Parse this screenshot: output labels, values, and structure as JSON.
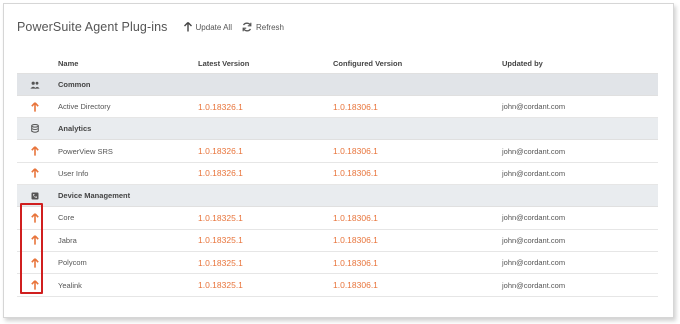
{
  "header": {
    "title": "PowerSuite Agent Plug-ins",
    "update_all_label": "Update All",
    "refresh_label": "Refresh"
  },
  "columns": {
    "name": "Name",
    "latest": "Latest Version",
    "configured": "Configured Version",
    "updated_by": "Updated by"
  },
  "groups": [
    {
      "name": "Common",
      "icon": "users-icon",
      "rows": [
        {
          "name": "Active Directory",
          "latest": "1.0.18326.1",
          "configured": "1.0.18306.1",
          "updated_by": "john@cordant.com"
        }
      ]
    },
    {
      "name": "Analytics",
      "icon": "database-icon",
      "rows": [
        {
          "name": "PowerView SRS",
          "latest": "1.0.18326.1",
          "configured": "1.0.18306.1",
          "updated_by": "john@cordant.com"
        },
        {
          "name": "User Info",
          "latest": "1.0.18326.1",
          "configured": "1.0.18306.1",
          "updated_by": "john@cordant.com"
        }
      ]
    },
    {
      "name": "Device Management",
      "icon": "phone-icon",
      "rows": [
        {
          "name": "Core",
          "latest": "1.0.18325.1",
          "configured": "1.0.18306.1",
          "updated_by": "john@cordant.com"
        },
        {
          "name": "Jabra",
          "latest": "1.0.18325.1",
          "configured": "1.0.18306.1",
          "updated_by": "john@cordant.com"
        },
        {
          "name": "Polycom",
          "latest": "1.0.18325.1",
          "configured": "1.0.18306.1",
          "updated_by": "john@cordant.com"
        },
        {
          "name": "Yealink",
          "latest": "1.0.18325.1",
          "configured": "1.0.18306.1",
          "updated_by": "john@cordant.com"
        }
      ]
    }
  ],
  "colors": {
    "accent": "#e8743b",
    "highlight_box": "#d01f1f",
    "group_background": "#e9ecef"
  }
}
